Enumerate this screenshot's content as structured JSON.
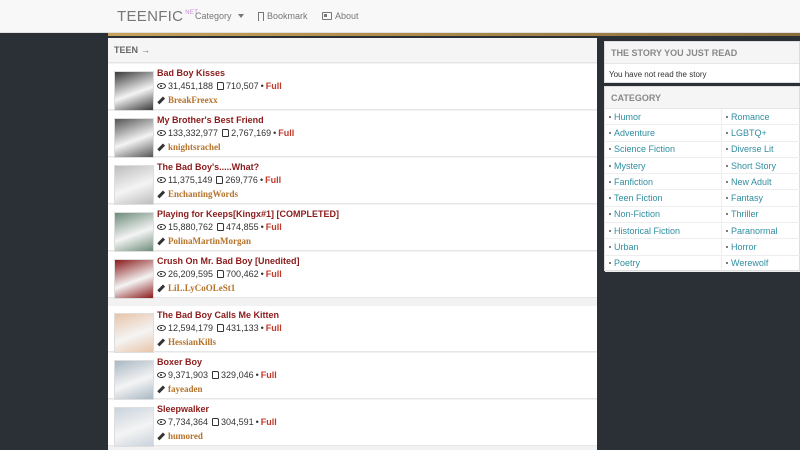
{
  "navbar": {
    "brand": "TEENFIC",
    "brand_sup": "NET",
    "category_label": "Category",
    "bookmark_label": "Bookmark",
    "about_label": "About"
  },
  "section": {
    "title": "TEEN",
    "arrow": "→"
  },
  "stories": [
    {
      "title": "Bad Boy Kisses",
      "views": "31,451,188",
      "likes": "710,507",
      "status": "Full",
      "author": "BreakFreexx",
      "cover_color": "#3a3a3a"
    },
    {
      "title": "My Brother's Best Friend",
      "views": "133,332,977",
      "likes": "2,767,169",
      "status": "Full",
      "author": "knightsrachel",
      "cover_color": "#555555"
    },
    {
      "title": "The Bad Boy's.....What?",
      "views": "11,375,149",
      "likes": "269,776",
      "status": "Full",
      "author": "EnchantingWords",
      "cover_color": "#bdbdbd"
    },
    {
      "title": "Playing for Keeps[Kingx#1] [COMPLETED]",
      "views": "15,880,762",
      "likes": "474,855",
      "status": "Full",
      "author": "PolinaMartinMorgan",
      "cover_color": "#6d8c7a"
    },
    {
      "title": "Crush On Mr. Bad Boy [Unedited]",
      "views": "26,209,595",
      "likes": "700,462",
      "status": "Full",
      "author": "LiL.LyCoOLeSt1",
      "cover_color": "#8b1a1a"
    },
    {
      "title": "The Bad Boy Calls Me Kitten",
      "views": "12,594,179",
      "likes": "431,133",
      "status": "Full",
      "author": "HessianKills",
      "cover_color": "#e8c4a8"
    },
    {
      "title": "Boxer Boy",
      "views": "9,371,903",
      "likes": "329,046",
      "status": "Full",
      "author": "fayeaden",
      "cover_color": "#a9b8c4"
    },
    {
      "title": "Sleepwalker",
      "views": "7,734,364",
      "likes": "304,591",
      "status": "Full",
      "author": "humored",
      "cover_color": "#c9d2dc"
    }
  ],
  "sidebar": {
    "recent_title": "THE STORY YOU JUST READ",
    "recent_empty": "You have not read the story",
    "category_title": "CATEGORY",
    "categories": [
      "Humor",
      "Romance",
      "Adventure",
      "LGBTQ+",
      "Science Fiction",
      "Diverse Lit",
      "Mystery",
      "Short Story",
      "Fanfiction",
      "New Adult",
      "Teen Fiction",
      "Fantasy",
      "Non-Fiction",
      "Thriller",
      "Historical Fiction",
      "Paranormal",
      "Urban",
      "Horror",
      "Poetry",
      "Werewolf"
    ]
  },
  "colors": {
    "title": "#8b1a1a",
    "author": "#b5722a",
    "full": "#c0392b",
    "category_link": "#2f8ea0"
  }
}
